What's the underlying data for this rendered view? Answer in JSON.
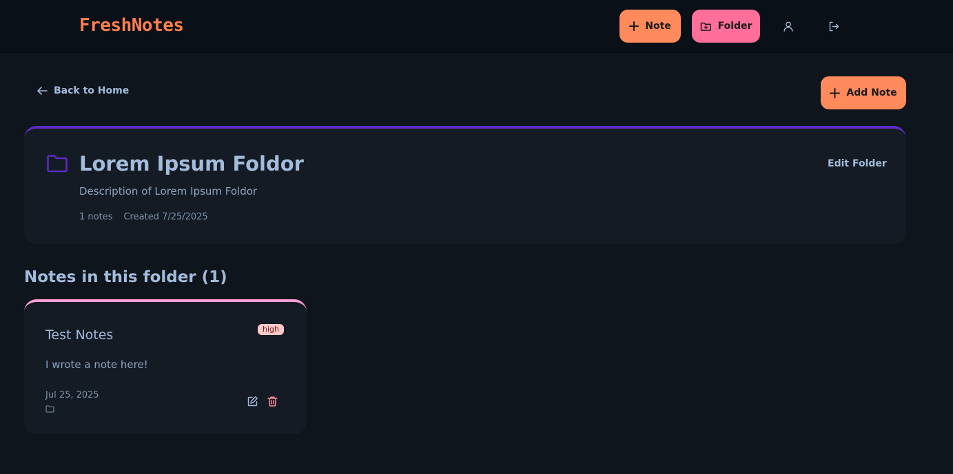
{
  "app": {
    "name": "FreshNotes"
  },
  "header": {
    "new_note_label": "Note",
    "new_folder_label": "Folder",
    "icons": [
      "user-icon",
      "logout-icon"
    ]
  },
  "nav": {
    "back_label": "Back to Home",
    "add_note_label": "Add Note"
  },
  "folder": {
    "title": "Lorem Ipsum Foldor",
    "description": "Description of Lorem Ipsum Foldor",
    "note_count": "1 notes",
    "created": "Created 7/25/2025",
    "edit_label": "Edit Folder",
    "accent_color": "#5b2bc4"
  },
  "notes_section": {
    "title": "Notes in this folder (1)"
  },
  "notes": [
    {
      "title": "Test Notes",
      "priority": "high",
      "body": "I wrote a note here!",
      "date": "Jul 25, 2025",
      "accent_color": "#ff9ed6"
    }
  ],
  "colors": {
    "brand": "#ff7f50",
    "primary_button": "#ff8a5b",
    "folder_button": "#ff6f9a",
    "text": "#a3bcdc",
    "background": "#0f151d"
  }
}
